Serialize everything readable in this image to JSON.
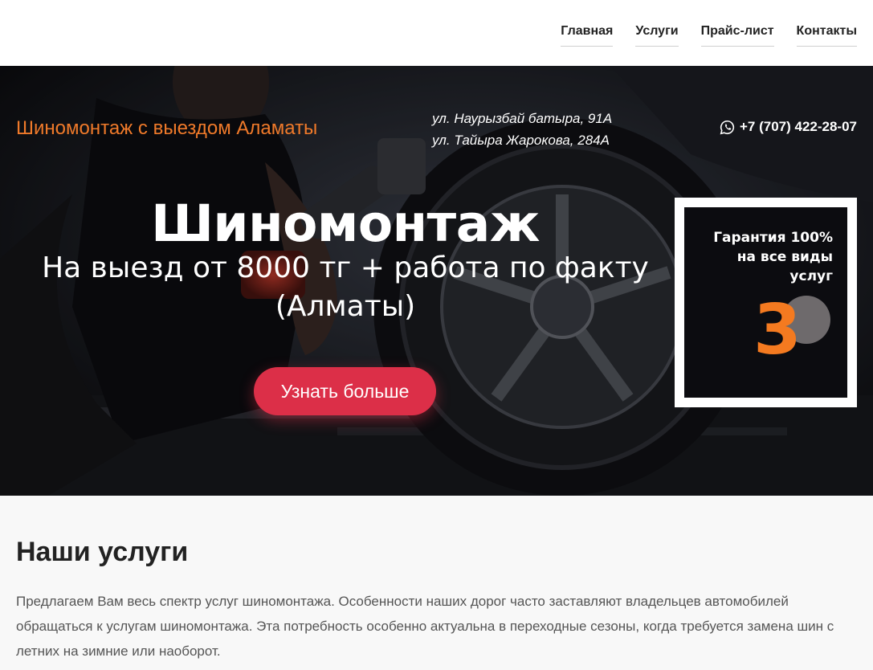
{
  "nav": {
    "items": [
      {
        "label": "Главная"
      },
      {
        "label": "Услуги"
      },
      {
        "label": "Прайс-лист"
      },
      {
        "label": "Контакты"
      }
    ]
  },
  "hero": {
    "brand": "Шиномонтаж с выездом Аламаты",
    "address_lines": [
      "ул. Наурызбай батыра, 91А",
      "ул. Тайыра Жарокова, 284А"
    ],
    "phone": "+7 (707) 422-28-07",
    "phone_icon": "whatsapp-icon",
    "title": "Шиномонтаж",
    "subtitle_line1": "На выезд от 8000 тг + работа по факту",
    "subtitle_line2": "(Алматы)",
    "cta_label": "Узнать больше",
    "badge": {
      "line1": "Гарантия 100%",
      "line2": "на все виды",
      "line3": "услуг",
      "number": "3"
    },
    "colors": {
      "brand": "#f07a2a",
      "cta": "#dc2f48",
      "badge_number": "#f47a20"
    }
  },
  "services": {
    "heading": "Наши услуги",
    "text": "Предлагаем Вам весь спектр услуг шиномонтажа. Особенности наших дорог часто заставляют владельцев автомобилей обращаться к услугам шиномонтажа. Эта потребность особенно актуальна в переходные сезоны, когда требуется замена шин с летних на зимние или наоборот."
  }
}
